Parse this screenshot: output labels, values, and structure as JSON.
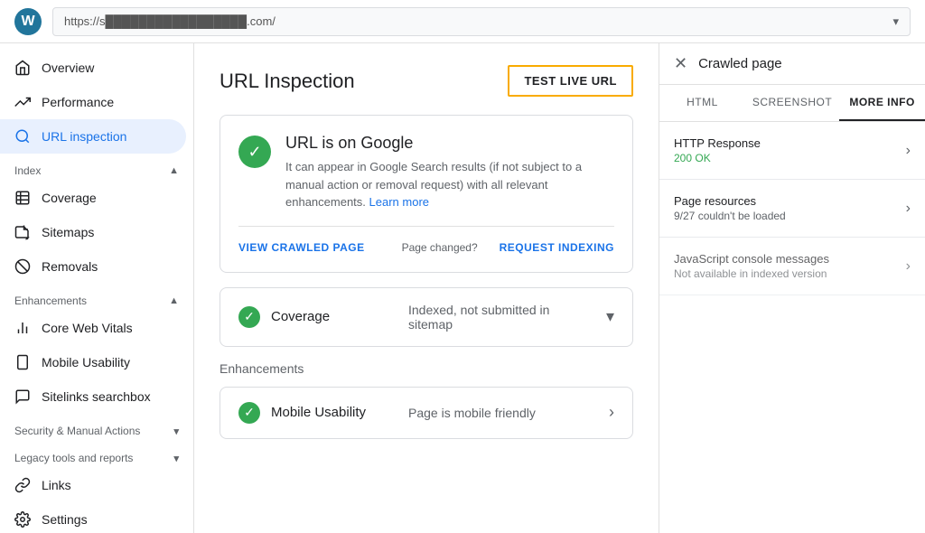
{
  "topbar": {
    "url": "https://s█████████████████.com/",
    "logo_letter": "W"
  },
  "sidebar": {
    "overview_label": "Overview",
    "performance_label": "Performance",
    "url_inspection_label": "URL inspection",
    "index_section": "Index",
    "coverage_label": "Coverage",
    "sitemaps_label": "Sitemaps",
    "removals_label": "Removals",
    "enhancements_section": "Enhancements",
    "core_web_vitals_label": "Core Web Vitals",
    "mobile_usability_label": "Mobile Usability",
    "sitelinks_searchbox_label": "Sitelinks searchbox",
    "security_section": "Security & Manual Actions",
    "legacy_section": "Legacy tools and reports",
    "links_label": "Links",
    "settings_label": "Settings"
  },
  "main": {
    "title": "URL Inspection",
    "test_live_url_btn": "TEST LIVE URL",
    "status_title": "URL is on Google",
    "status_desc": "It can appear in Google Search results (if not subject to a manual action or removal request) with all relevant enhancements.",
    "learn_more": "Learn more",
    "view_crawled_page_btn": "VIEW CRAWLED PAGE",
    "page_changed_label": "Page changed?",
    "request_indexing_btn": "REQUEST INDEXING",
    "coverage_label": "Coverage",
    "coverage_status": "Indexed, not submitted in sitemap",
    "enhancements_label": "Enhancements",
    "mobile_usability_label": "Mobile Usability",
    "mobile_usability_status": "Page is mobile friendly"
  },
  "right_panel": {
    "title": "Crawled page",
    "tab_html": "HTML",
    "tab_screenshot": "SCREENSHOT",
    "tab_more_info": "MORE INFO",
    "http_response_label": "HTTP Response",
    "http_response_value": "200 OK",
    "page_resources_label": "Page resources",
    "page_resources_value": "9/27 couldn't be loaded",
    "js_console_label": "JavaScript console messages",
    "js_console_value": "Not available in indexed version"
  }
}
